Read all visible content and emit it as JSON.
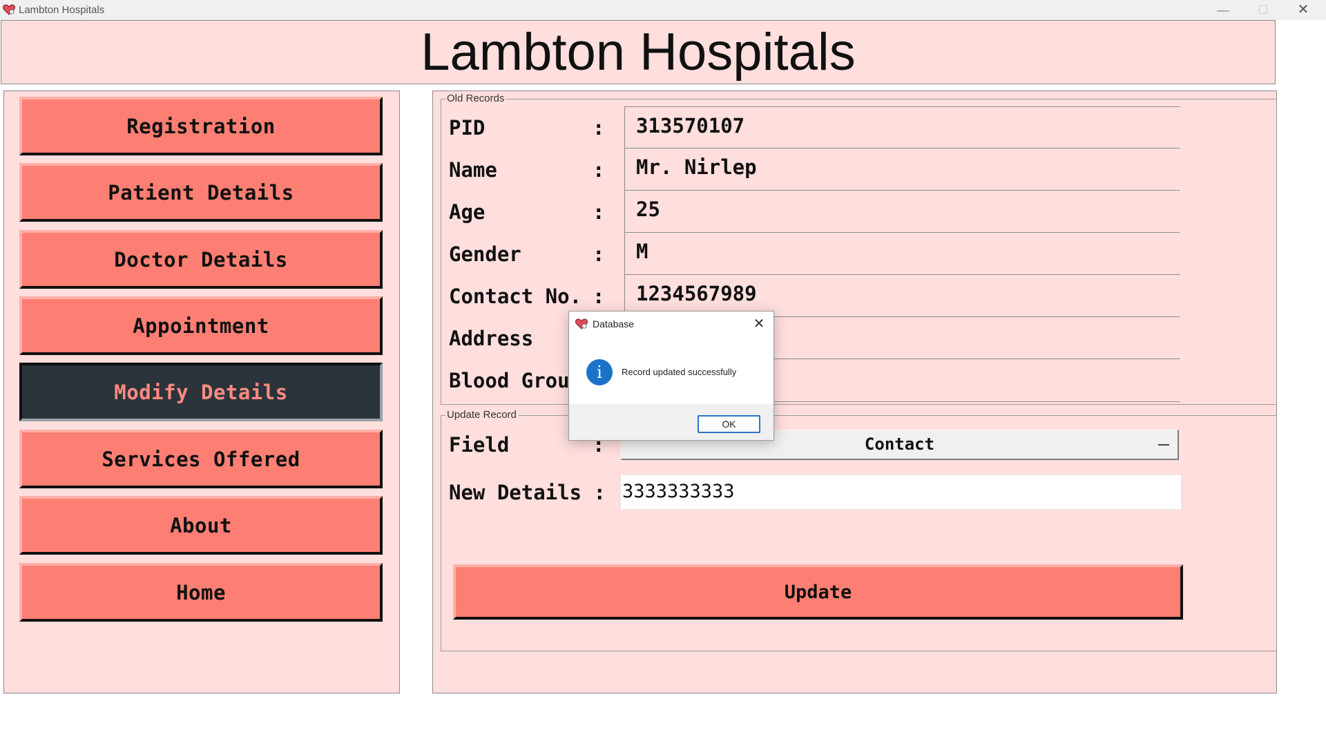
{
  "window": {
    "title": "Lambton Hospitals",
    "min_glyph": "—",
    "max_glyph": "☐",
    "close_glyph": "✕"
  },
  "header": {
    "title": "Lambton Hospitals"
  },
  "nav": {
    "items": [
      {
        "label": "Registration",
        "active": false
      },
      {
        "label": "Patient Details",
        "active": false
      },
      {
        "label": "Doctor Details",
        "active": false
      },
      {
        "label": "Appointment",
        "active": false
      },
      {
        "label": "Modify Details",
        "active": true
      },
      {
        "label": "Services Offered",
        "active": false
      },
      {
        "label": "About",
        "active": false
      },
      {
        "label": "Home",
        "active": false
      }
    ]
  },
  "old_records": {
    "legend": "Old Records",
    "colon": ":",
    "fields": [
      {
        "label": "PID",
        "value": "313570107"
      },
      {
        "label": "Name",
        "value": "Mr. Nirlep"
      },
      {
        "label": "Age",
        "value": "25"
      },
      {
        "label": "Gender",
        "value": "M"
      },
      {
        "label": "Contact No.",
        "value": "1234567989"
      },
      {
        "label": "Address",
        "value": ""
      },
      {
        "label": "Blood Grou",
        "value": ""
      }
    ]
  },
  "update_record": {
    "legend": "Update Record",
    "field_label": "Field",
    "colon": ":",
    "field_value": "Contact",
    "new_details_label": "New Details :",
    "new_details_value": "3333333333",
    "update_label": "Update"
  },
  "dialog": {
    "title": "Database",
    "message": "Record updated successfully",
    "ok_label": "OK",
    "info_glyph": "i",
    "close_glyph": "✕"
  },
  "colors": {
    "panel_bg": "#ffdede",
    "button_bg": "#fd7f73",
    "active_button_bg": "#2b333b",
    "active_button_text": "#ff8b80",
    "info_blue": "#1a73c8"
  }
}
